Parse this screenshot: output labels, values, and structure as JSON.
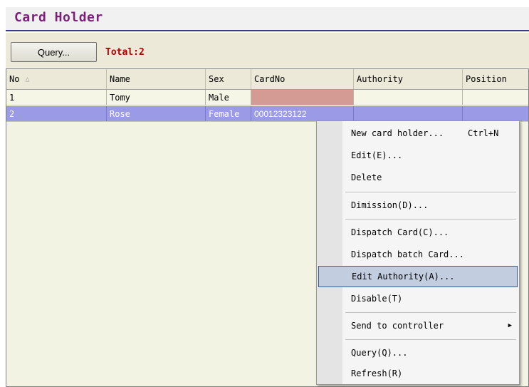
{
  "window": {
    "title": "Card Holder"
  },
  "toolbar": {
    "query_label": "Query...",
    "total_text": "Total:2"
  },
  "table": {
    "columns": [
      "No",
      "Name",
      "Sex",
      "CardNo",
      "Authority",
      "Position"
    ],
    "rows": [
      {
        "no": "1",
        "name": "Tomy",
        "sex": "Male",
        "cardno": "",
        "authority": "",
        "position": ""
      },
      {
        "no": "2",
        "name": "Rose",
        "sex": "Female",
        "cardno": "00012323122",
        "authority": "",
        "position": ""
      }
    ],
    "sort_icon": "sort-ascending-icon"
  },
  "context_menu": {
    "items": [
      {
        "text": "New card holder...",
        "shortcut": "Ctrl+N"
      },
      {
        "text": "Edit(E)..."
      },
      {
        "text": "Delete"
      },
      {
        "text": "Dimission(D)..."
      },
      {
        "text": "Dispatch Card(C)..."
      },
      {
        "text": "Dispatch batch Card..."
      },
      {
        "text": "Edit Authority(A)..."
      },
      {
        "text": "Disable(T)"
      },
      {
        "text": "Send to controller",
        "submenu_icon": "submenu-arrow-icon"
      },
      {
        "text": "Query(Q)..."
      },
      {
        "text": "Refresh(R)"
      }
    ],
    "highlighted": "Edit Authority(A)..."
  },
  "colors": {
    "title": "#7b1f7b",
    "total": "#b00000",
    "selected_row": "#9a9ae6",
    "menu_highlight": "#c3cde0"
  }
}
